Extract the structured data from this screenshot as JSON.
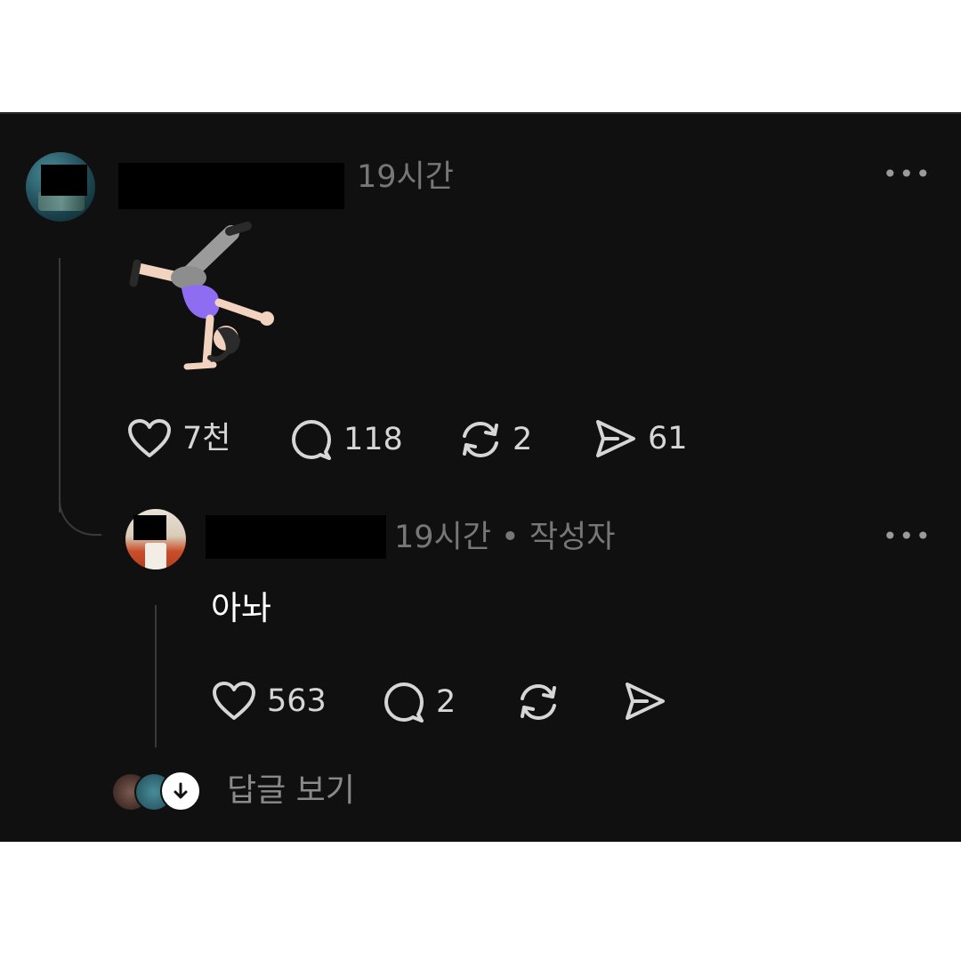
{
  "post": {
    "timestamp": "19시간",
    "more_label": "•••",
    "emoji_icon": "person-cartwheeling-emoji",
    "actions": {
      "like_count": "7천",
      "comment_count": "118",
      "repost_count": "2",
      "share_count": "61"
    }
  },
  "reply": {
    "meta": "19시간 • 작성자",
    "more_label": "•••",
    "text": "아놔",
    "actions": {
      "like_count": "563",
      "comment_count": "2"
    }
  },
  "footer": {
    "view_replies_label": "답글 보기"
  },
  "colors": {
    "background": "#101010",
    "text_primary": "#ffffff",
    "text_secondary": "#777777",
    "icon": "#d6d6d6"
  }
}
